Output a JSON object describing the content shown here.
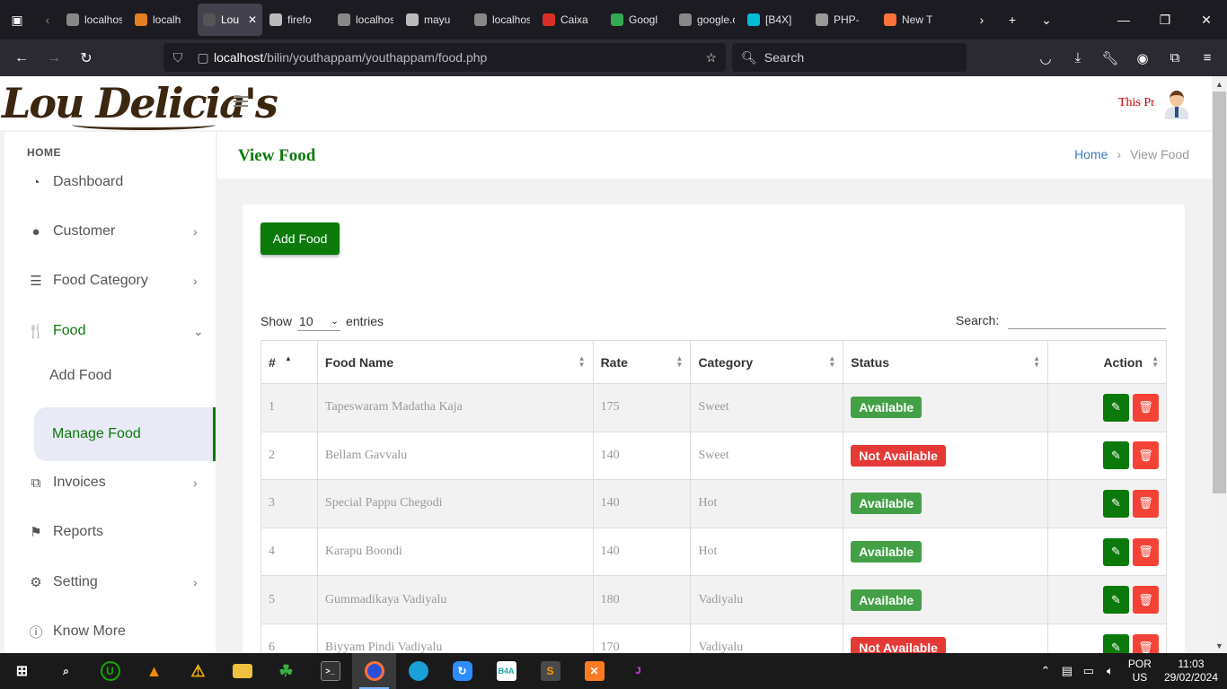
{
  "browser": {
    "tabs": [
      {
        "label": "localhost/",
        "color": "#888"
      },
      {
        "label": "localh",
        "color": "#e67e22"
      },
      {
        "label": "Lou Del",
        "color": "#555",
        "active": true
      },
      {
        "label": "firefo",
        "color": "#bbb"
      },
      {
        "label": "localhost/",
        "color": "#888"
      },
      {
        "label": "mayu",
        "color": "#bbb"
      },
      {
        "label": "localhost/",
        "color": "#888"
      },
      {
        "label": "Caixa",
        "color": "#d93025"
      },
      {
        "label": "Googl",
        "color": "#34a853"
      },
      {
        "label": "google.co",
        "color": "#888"
      },
      {
        "label": "[B4X]",
        "color": "#00bcd4"
      },
      {
        "label": "PHP-",
        "color": "#999"
      },
      {
        "label": "New T",
        "color": "#ff7139"
      }
    ],
    "url_host": "localhost",
    "url_path": "/bilin/youthappam/youthappam/food.php",
    "search_placeholder": "Search"
  },
  "header": {
    "logo_text": "Lou Delicia's",
    "marquee_text": "This Pr"
  },
  "sidebar": {
    "section_label": "HOME",
    "items": [
      {
        "label": "Dashboard",
        "icon": "dashboard-icon",
        "glyph": "◔",
        "chevron": false
      },
      {
        "label": "Customer",
        "icon": "user-icon",
        "glyph": "●",
        "chevron": true
      },
      {
        "label": "Food Category",
        "icon": "list-icon",
        "glyph": "☰",
        "chevron": true
      },
      {
        "label": "Food",
        "icon": "utensils-icon",
        "glyph": "🍴",
        "chevron": true,
        "open": true
      },
      {
        "label": "Invoices",
        "icon": "invoice-icon",
        "glyph": "⧉",
        "chevron": true
      },
      {
        "label": "Reports",
        "icon": "flag-icon",
        "glyph": "⚑",
        "chevron": false
      },
      {
        "label": "Setting",
        "icon": "gear-icon",
        "glyph": "⚙",
        "chevron": true
      },
      {
        "label": "Know More",
        "icon": "info-icon",
        "glyph": "ⓘ",
        "chevron": false
      }
    ],
    "sub_items": [
      {
        "label": "Add Food"
      },
      {
        "label": "Manage Food",
        "active": true
      }
    ]
  },
  "content": {
    "page_title": "View Food",
    "breadcrumb_home": "Home",
    "breadcrumb_current": "View Food",
    "add_button": "Add Food",
    "show_label": "Show",
    "entries_value": "10",
    "entries_label": "entries",
    "search_label": "Search:",
    "table": {
      "headers": [
        "#",
        "Food Name",
        "Rate",
        "Category",
        "Status",
        "Action"
      ],
      "rows": [
        {
          "num": "1",
          "name": "Tapeswaram Madatha Kaja",
          "rate": "175",
          "category": "Sweet",
          "status": "Available"
        },
        {
          "num": "2",
          "name": "Bellam Gavvalu",
          "rate": "140",
          "category": "Sweet",
          "status": "Not Available"
        },
        {
          "num": "3",
          "name": "Special Pappu Chegodi",
          "rate": "140",
          "category": "Hot",
          "status": "Available"
        },
        {
          "num": "4",
          "name": "Karapu Boondi",
          "rate": "140",
          "category": "Hot",
          "status": "Available"
        },
        {
          "num": "5",
          "name": "Gummadikaya Vadiyalu",
          "rate": "180",
          "category": "Vadiyalu",
          "status": "Available"
        },
        {
          "num": "6",
          "name": "Biyyam Pindi Vadiyalu",
          "rate": "170",
          "category": "Vadiyalu",
          "status": "Not Available"
        }
      ]
    }
  },
  "taskbar": {
    "lang_top": "POR",
    "lang_bottom": "US",
    "time": "11:03",
    "date": "29/02/2024"
  },
  "colors": {
    "brand_green": "#0b7a0b",
    "available": "#43a047",
    "not_available": "#e53935"
  }
}
